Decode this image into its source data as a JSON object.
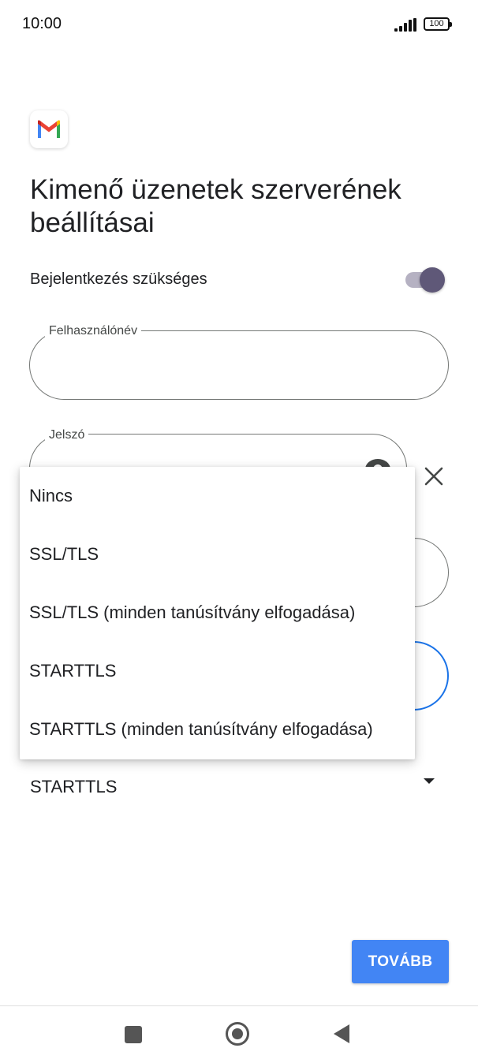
{
  "status_bar": {
    "time": "10:00",
    "battery": "100"
  },
  "logo_icon": "gmail-logo",
  "page_title": "Kimenő üzenetek szerverének beállításai",
  "login_required": {
    "label": "Bejelentkezés szükséges",
    "enabled": true
  },
  "username_field": {
    "label": "Felhasználónév",
    "value": ""
  },
  "password_field": {
    "label": "Jelszó",
    "value": ""
  },
  "security_menu": {
    "options": [
      "Nincs",
      "SSL/TLS",
      "SSL/TLS (minden tanúsítvány elfogadása)",
      "STARTTLS",
      "STARTTLS (minden tanúsítvány elfogadása)"
    ]
  },
  "security_select": {
    "value": "STARTTLS"
  },
  "next_button": {
    "label": "TOVÁBB"
  },
  "colors": {
    "accent": "#4285f4",
    "toggle_thumb": "#5f5878",
    "toggle_track": "#b5b1c2",
    "focus_outline": "#1a73e8"
  },
  "nav_icons": [
    "recents-icon",
    "home-icon",
    "back-icon"
  ]
}
